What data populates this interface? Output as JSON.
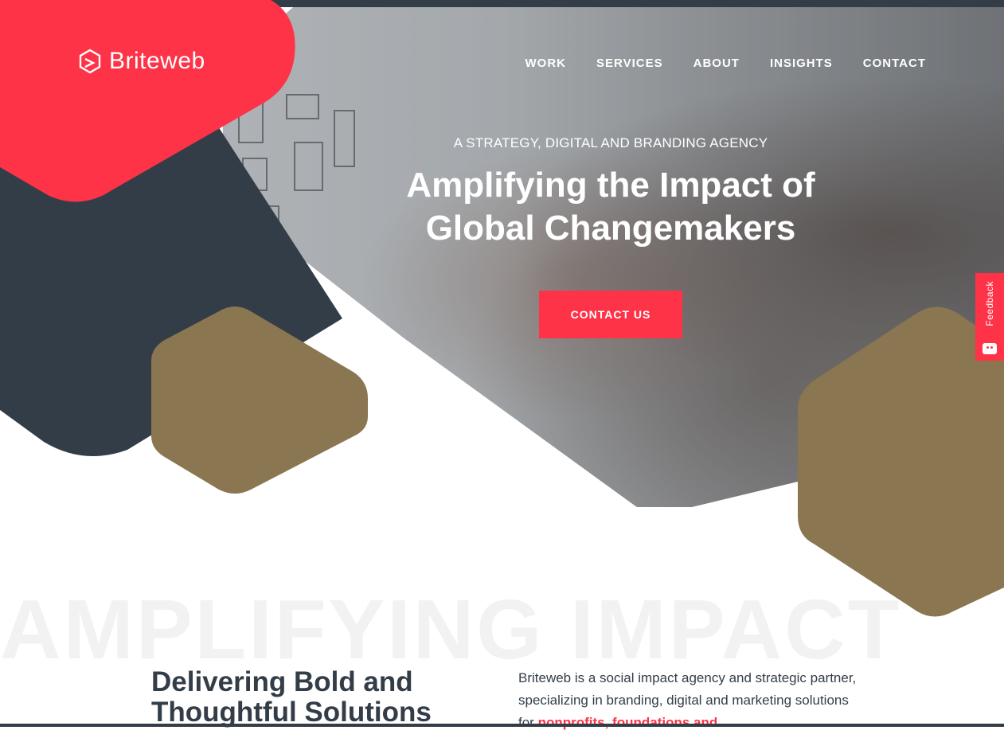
{
  "brand": {
    "name": "Briteweb",
    "logo_icon": "briteweb-hex-icon"
  },
  "nav": {
    "items": [
      "WORK",
      "SERVICES",
      "ABOUT",
      "INSIGHTS",
      "CONTACT"
    ]
  },
  "hero": {
    "eyebrow": "A STRATEGY, DIGITAL AND BRANDING AGENCY",
    "headline_line1": "Amplifying the Impact of",
    "headline_line2": "Global Changemakers",
    "cta_label": "CONTACT US"
  },
  "feedback": {
    "label": "Feedback",
    "icon": "smiley-face-icon"
  },
  "section": {
    "watermark": "AMPLIFYING IMPACT",
    "heading": "Delivering Bold and Thoughtful Solutions",
    "intro_text": "Briteweb is a social impact agency and strategic partner, specializing in branding, digital and marketing solutions for ",
    "intro_highlight": "nonprofits, foundations and"
  },
  "colors": {
    "accent": "#fe3347",
    "dark": "#333d48",
    "gold": "#8a7650"
  }
}
